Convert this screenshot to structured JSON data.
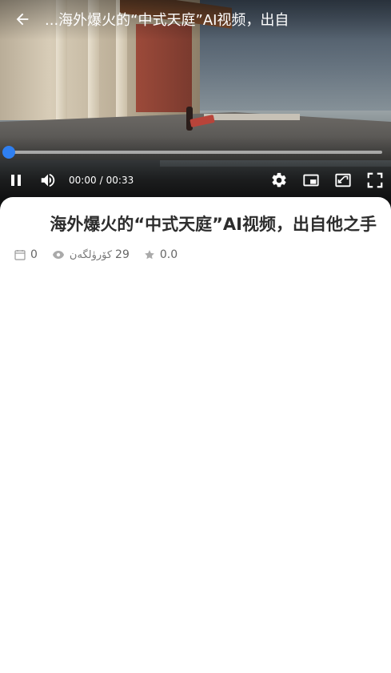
{
  "player": {
    "title": "...海外爆火的“中式天庭”AI视频，出自",
    "progress_fraction": 0.0,
    "time_current": "00:00",
    "time_separator": "/",
    "time_total": "00:33",
    "accent_color": "#2f7ff0"
  },
  "content": {
    "title": "海外爆火的“中式天庭”AI视频，出自他之手",
    "meta": {
      "date_value": "0",
      "views_label": "كۆرۈلگەن",
      "views_value": "29",
      "rating_value": "0.0"
    }
  },
  "icons": {
    "back": "arrow-left-icon",
    "pause": "pause-icon",
    "volume": "volume-icon",
    "settings": "gear-icon",
    "pip": "picture-in-picture-icon",
    "aspect": "aspect-ratio-icon",
    "fullscreen": "fullscreen-icon",
    "calendar": "calendar-icon",
    "eye": "eye-icon",
    "star": "star-icon"
  }
}
